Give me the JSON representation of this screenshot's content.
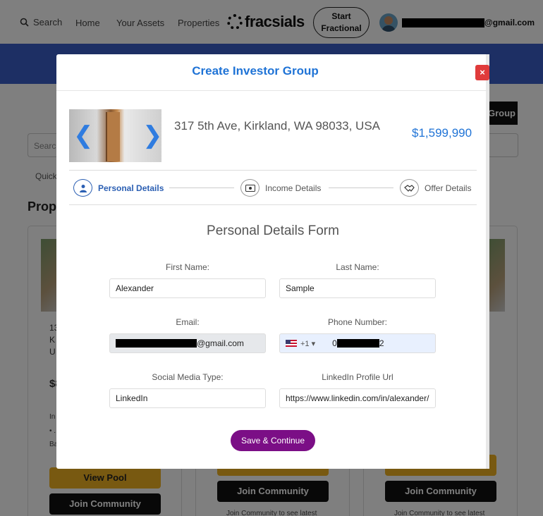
{
  "nav": {
    "search": "Search",
    "home": "Home",
    "assets": "Your Assets",
    "properties": "Properties",
    "logo": "fracsials",
    "start_btn": "Start\nFractional",
    "user_email_suffix": "@gmail.com"
  },
  "background": {
    "group_btn": "Group",
    "search_placeholder": "Search",
    "quick": "Quick",
    "section_title": "Prope",
    "card_partial_1": "13",
    "card_partial_2": "K",
    "card_partial_3": "U",
    "card_price_partial": "$8",
    "card_in": "In",
    "card_dot": "• .",
    "card_ba": "Ba",
    "view_pool": "View Pool",
    "join_community": "Join Community",
    "join_note": "Join Community to see latest"
  },
  "modal": {
    "title": "Create Investor Group",
    "close": "×",
    "property": {
      "address": "317 5th Ave, Kirkland, WA 98033, USA",
      "price": "$1,599,990"
    },
    "steps": [
      {
        "label": "Personal Details",
        "icon": "user-icon"
      },
      {
        "label": "Income Details",
        "icon": "money-icon"
      },
      {
        "label": "Offer Details",
        "icon": "handshake-icon"
      }
    ],
    "form": {
      "title": "Personal Details Form",
      "first_name_label": "First Name:",
      "first_name": "Alexander",
      "last_name_label": "Last Name:",
      "last_name": "Sample",
      "email_label": "Email:",
      "email_suffix": "@gmail.com",
      "phone_label": "Phone Number:",
      "phone_code": "+1",
      "phone_prefix": "0",
      "phone_suffix": "2",
      "social_label": "Social Media Type:",
      "social": "LinkedIn",
      "linkedin_label": "LinkedIn Profile Url",
      "linkedin": "https://www.linkedin.com/in/alexander/",
      "save_label": "Save & Continue"
    }
  },
  "colors": {
    "accent": "#1f73d6",
    "save": "#7b0e86",
    "close": "#e03b3b",
    "band": "#3a5fc8"
  }
}
